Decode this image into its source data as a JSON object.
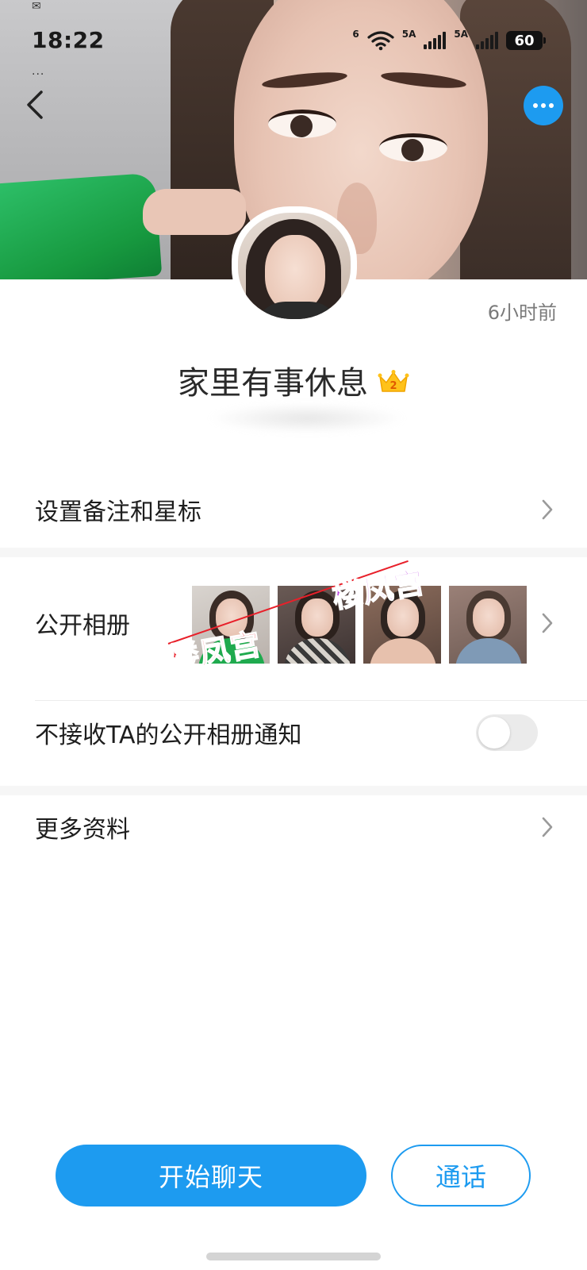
{
  "status_bar": {
    "time": "18:22",
    "network_left": "6",
    "signal1_label": "5A",
    "signal2_label": "5A",
    "battery": "60"
  },
  "header": {
    "back_icon": "chevron-left-icon",
    "more_icon": "more-dots-icon",
    "accent_color": "#1d9bf0"
  },
  "profile": {
    "last_seen": "6小时前",
    "name": "家里有事休息",
    "badge_number": "2",
    "badge_icon": "crown-icon"
  },
  "rows": {
    "remark_label": "设置备注和星标",
    "album_label": "公开相册",
    "album_watermark": "楼凤宫",
    "notify_label": "不接收TA的公开相册通知",
    "notify_toggle_on": false,
    "more_info_label": "更多资料"
  },
  "actions": {
    "chat_label": "开始聊天",
    "call_label": "通话"
  }
}
